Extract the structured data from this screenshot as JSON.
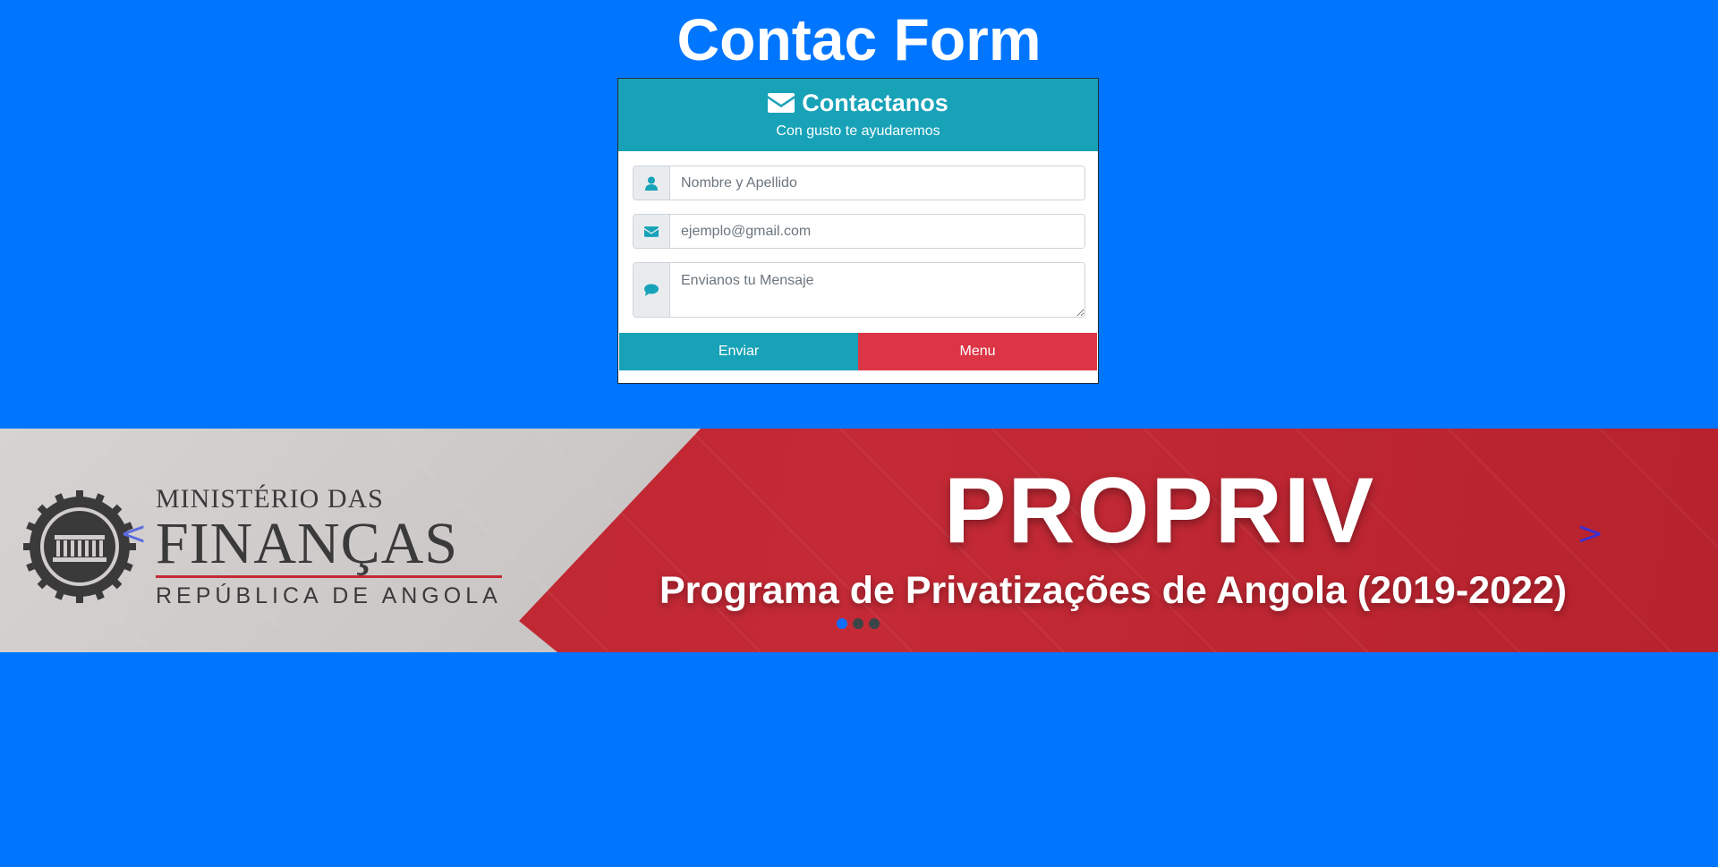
{
  "page": {
    "title": "Contac Form",
    "background_color": "#0076ff"
  },
  "contact_card": {
    "header": {
      "icon": "envelope-icon",
      "title": "Contactanos",
      "subtitle": "Con gusto te ayudaremos",
      "color": "#17a2b8"
    },
    "fields": {
      "name": {
        "icon": "user-icon",
        "placeholder": "Nombre y Apellido",
        "value": ""
      },
      "email": {
        "icon": "envelope-icon",
        "placeholder": "ejemplo@gmail.com",
        "value": ""
      },
      "message": {
        "icon": "comment-icon",
        "placeholder": "Envianos tu Mensaje",
        "value": ""
      }
    },
    "buttons": {
      "send_label": "Enviar",
      "send_color": "#17a2b8",
      "menu_label": "Menu",
      "menu_color": "#dc3545"
    }
  },
  "carousel": {
    "slide": {
      "ministry_top": "MINISTÉRIO DAS",
      "ministry_main": "FINANÇAS",
      "ministry_sub": "REPÚBLICA DE ANGOLA",
      "headline": "PROPRIV",
      "subheadline": "Programa de Privatizações de Angola (2019-2022)"
    },
    "prev_label": "<",
    "next_label": ">",
    "indicators": [
      {
        "active": true
      },
      {
        "active": false
      },
      {
        "active": false
      }
    ]
  }
}
